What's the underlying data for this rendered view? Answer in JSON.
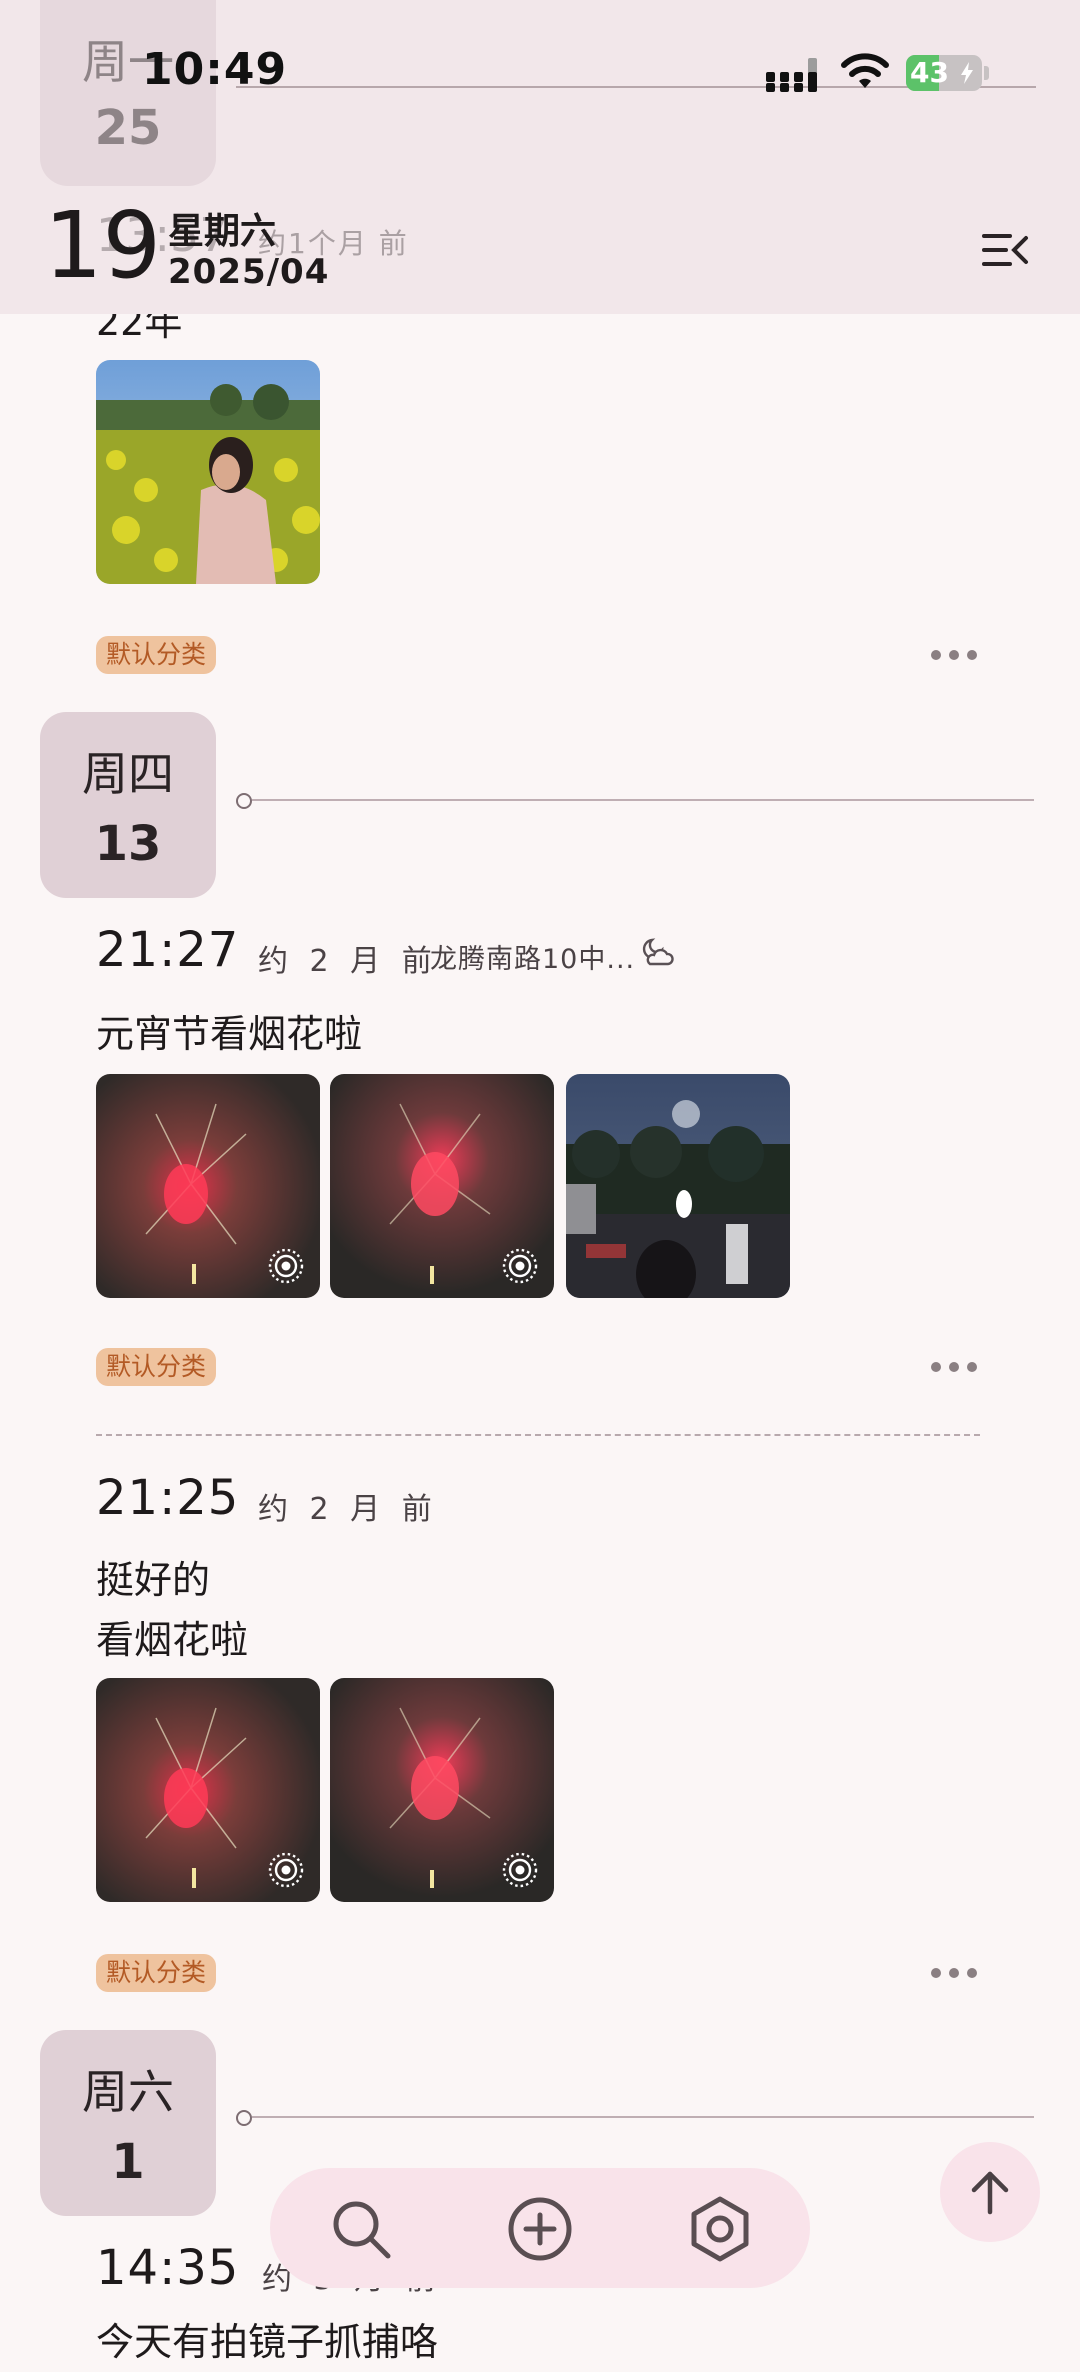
{
  "status_bar": {
    "time": "10:49",
    "battery": "43"
  },
  "header": {
    "ghost": {
      "weekday": "周一",
      "day": "25",
      "time": "13:57",
      "ago": "约1个月 前"
    },
    "day": "19",
    "weekday": "星期六",
    "year_month": "2025/04"
  },
  "feed": {
    "top_entry": {
      "text": "22年",
      "tag": "默认分类"
    },
    "groups": [
      {
        "weekday": "周四",
        "day": "13",
        "entries": [
          {
            "time": "21:27",
            "ago": "约 2 月 前",
            "location": "龙腾南路10中...",
            "weather_icon": "cloudy-night-icon",
            "text": "元宵节看烟花啦",
            "tag": "默认分类"
          },
          {
            "time": "21:25",
            "ago": "约 2 月 前",
            "text_line1": "挺好的",
            "text_line2": "看烟花啦",
            "tag": "默认分类"
          }
        ]
      },
      {
        "weekday": "周六",
        "day": "1",
        "entries": [
          {
            "time": "14:35",
            "ago": "约 3 月 前",
            "text": "今天有拍镜子抓捕咯"
          }
        ]
      }
    ]
  },
  "bottom_bar": {
    "icons": [
      "search-icon",
      "add-icon",
      "settings-icon"
    ]
  },
  "colors": {
    "header_bg": "#f2e7ea",
    "page_bg": "#fbf6f6",
    "badge_bg": "#e0d0d6",
    "tag_bg": "#efc39e",
    "tag_text": "#b35a25",
    "bar_bg": "#f9e3ea"
  }
}
